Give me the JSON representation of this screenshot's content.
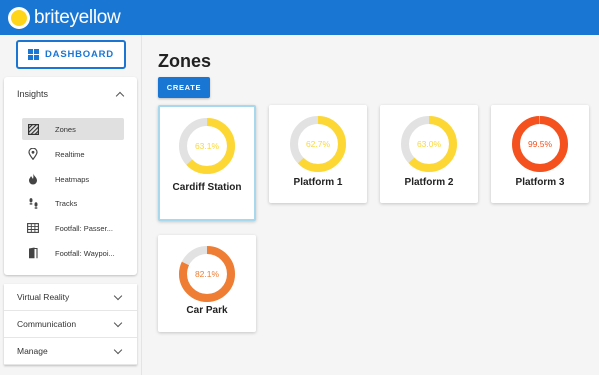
{
  "app": {
    "brand": "briteyellow"
  },
  "sidebar": {
    "dashboard_label": "DASHBOARD",
    "insights": {
      "title": "Insights",
      "items": [
        {
          "label": "Zones",
          "icon": "zones-icon",
          "active": true
        },
        {
          "label": "Realtime",
          "icon": "location-pin-icon"
        },
        {
          "label": "Heatmaps",
          "icon": "flame-icon"
        },
        {
          "label": "Tracks",
          "icon": "footsteps-icon"
        },
        {
          "label": "Footfall: Passer...",
          "icon": "table-icon"
        },
        {
          "label": "Footfall: Waypoi...",
          "icon": "door-icon"
        }
      ]
    },
    "sections": [
      {
        "label": "Virtual Reality"
      },
      {
        "label": "Communication"
      },
      {
        "label": "Manage"
      }
    ]
  },
  "main": {
    "title": "Zones",
    "create_label": "CREATE",
    "zones": [
      {
        "name": "Cardiff Station",
        "value": 63.1,
        "label": "63.1%",
        "color": "#fdd835",
        "selected": true
      },
      {
        "name": "Platform 1",
        "value": 62.7,
        "label": "62.7%",
        "color": "#fdd835"
      },
      {
        "name": "Platform 2",
        "value": 63.0,
        "label": "63.0%",
        "color": "#fdd835"
      },
      {
        "name": "Platform 3",
        "value": 99.5,
        "label": "99.5%",
        "color": "#f4511e"
      },
      {
        "name": "Car Park",
        "value": 82.1,
        "label": "82.1%",
        "color": "#ef7d33"
      }
    ]
  },
  "colors": {
    "primary": "#1976d2",
    "track": "#e2e2e2",
    "logo_sun": "#ffd51a"
  }
}
